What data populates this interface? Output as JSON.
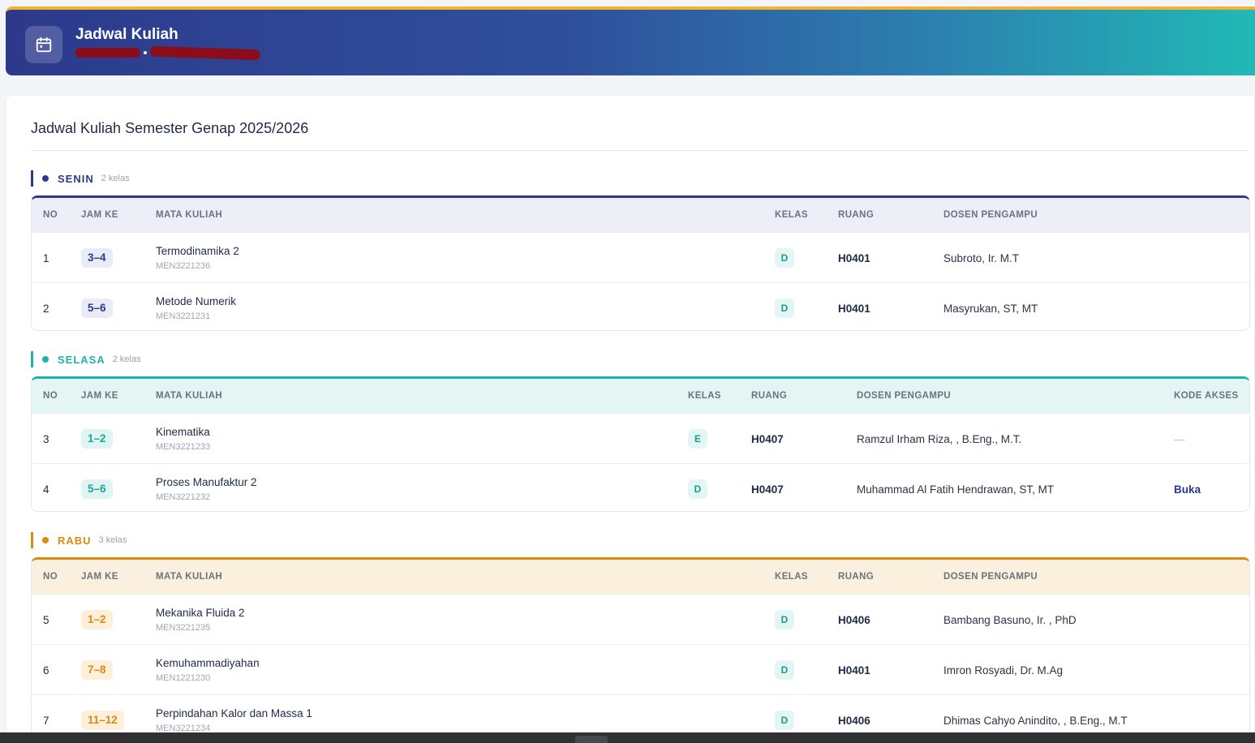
{
  "header": {
    "title": "Jadwal Kuliah",
    "icon": "calendar-icon",
    "colors": {
      "accent_top": "#f2b233",
      "gradient_start": "#2d3a8c",
      "gradient_end": "#21b9b5"
    }
  },
  "main": {
    "title": "Jadwal Kuliah Semester Genap 2025/2026"
  },
  "columns": {
    "no": "NO",
    "jam": "JAM KE",
    "mata_kuliah": "MATA KULIAH",
    "kelas": "KELAS",
    "ruang": "RUANG",
    "dosen": "DOSEN PENGAMPU",
    "akses": "KODE AKSES"
  },
  "days": [
    {
      "name": "SENIN",
      "count": "2 kelas",
      "color": "#2d3a8c",
      "header_bg": "#eceef8",
      "badge_bg": "#e9ebf7",
      "badge_fg": "#2d3a8c",
      "rows": [
        {
          "no": "1",
          "jam": "3–4",
          "name": "Termodinamika 2",
          "code": "MEN3221236",
          "kelas": "D",
          "ruang": "H0401",
          "dosen": "Subroto, Ir. M.T"
        },
        {
          "no": "2",
          "jam": "5–6",
          "name": "Metode Numerik",
          "code": "MEN3221231",
          "kelas": "D",
          "ruang": "H0401",
          "dosen": "Masyrukan, ST, MT"
        }
      ]
    },
    {
      "name": "SELASA",
      "count": "2 kelas",
      "color": "#1fb3a6",
      "header_bg": "#e4f6f4",
      "badge_bg": "#e0f5f2",
      "badge_fg": "#1aa89b",
      "rows": [
        {
          "no": "3",
          "jam": "1–2",
          "name": "Kinematika",
          "code": "MEN3221233",
          "kelas": "E",
          "ruang": "H0407",
          "dosen": "Ramzul Irham Riza, , B.Eng., M.T.",
          "akses": "—"
        },
        {
          "no": "4",
          "jam": "5–6",
          "name": "Proses Manufaktur 2",
          "code": "MEN3221232",
          "kelas": "D",
          "ruang": "H0407",
          "dosen": "Muhammad Al Fatih Hendrawan, ST, MT",
          "akses": "Buka"
        }
      ]
    },
    {
      "name": "RABU",
      "count": "3 kelas",
      "color": "#d98b12",
      "header_bg": "#fbf0de",
      "badge_bg": "#fdefd9",
      "badge_fg": "#d98b12",
      "rows": [
        {
          "no": "5",
          "jam": "1–2",
          "name": "Mekanika Fluida 2",
          "code": "MEN3221235",
          "kelas": "D",
          "ruang": "H0406",
          "dosen": "Bambang Basuno, Ir. , PhD"
        },
        {
          "no": "6",
          "jam": "7–8",
          "name": "Kemuhammadiyahan",
          "code": "MEN1221230",
          "kelas": "D",
          "ruang": "H0401",
          "dosen": "Imron Rosyadi, Dr. M.Ag"
        },
        {
          "no": "7",
          "jam": "11–12",
          "name": "Perpindahan Kalor dan Massa 1",
          "code": "MEN3221234",
          "kelas": "D",
          "ruang": "H0406",
          "dosen": "Dhimas Cahyo Anindito, , B.Eng., M.T"
        }
      ]
    }
  ]
}
